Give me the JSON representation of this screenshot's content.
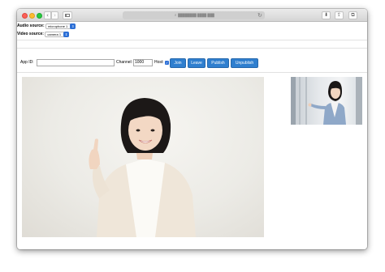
{
  "browser": {
    "address": "████████ ████ ███",
    "nav_back_icon": "‹",
    "nav_forward_icon": "›",
    "reload_icon": "↻",
    "share_icon": "⇪",
    "tabs_icon": "⧉",
    "download_icon": "⬇"
  },
  "sources": {
    "audio_label": "Audio source:",
    "audio_value": "microphone 1",
    "video_label": "Video source:",
    "video_value": "camera 1"
  },
  "controls": {
    "app_id_label": "App ID:",
    "app_id_value": "",
    "channel_label": "Channel:",
    "channel_value": "1000",
    "host_label": "Host:",
    "host_checked": true,
    "join_label": "Join",
    "leave_label": "Leave",
    "publish_label": "Publish",
    "unpublish_label": "Unpublish"
  },
  "colors": {
    "button_blue": "#2f7fcf",
    "select_caret_blue": "#2c6fd6",
    "traffic_close": "#fc5f57",
    "traffic_minimize": "#fdbc2e",
    "traffic_maximize": "#28c840"
  }
}
